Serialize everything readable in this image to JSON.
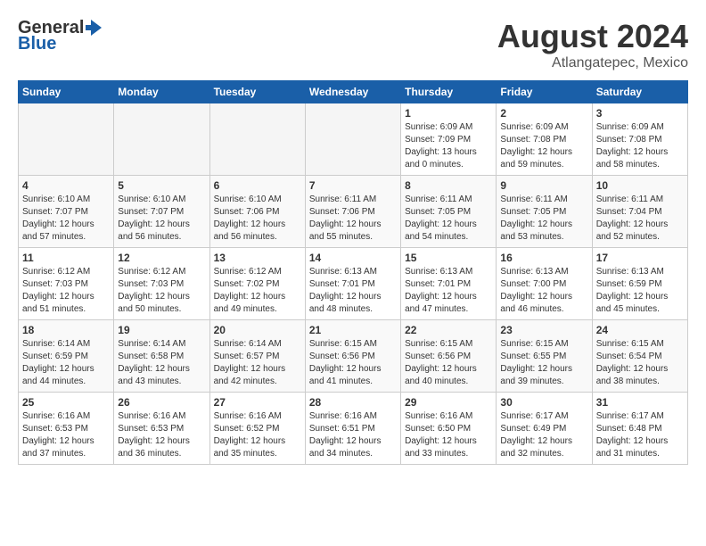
{
  "header": {
    "logo_general": "General",
    "logo_blue": "Blue",
    "main_title": "August 2024",
    "subtitle": "Atlangatepec, Mexico"
  },
  "weekdays": [
    "Sunday",
    "Monday",
    "Tuesday",
    "Wednesday",
    "Thursday",
    "Friday",
    "Saturday"
  ],
  "weeks": [
    [
      {
        "day": "",
        "empty": true
      },
      {
        "day": "",
        "empty": true
      },
      {
        "day": "",
        "empty": true
      },
      {
        "day": "",
        "empty": true
      },
      {
        "day": "1",
        "sunrise": "6:09 AM",
        "sunset": "7:09 PM",
        "daylight": "13 hours and 0 minutes."
      },
      {
        "day": "2",
        "sunrise": "6:09 AM",
        "sunset": "7:08 PM",
        "daylight": "12 hours and 59 minutes."
      },
      {
        "day": "3",
        "sunrise": "6:09 AM",
        "sunset": "7:08 PM",
        "daylight": "12 hours and 58 minutes."
      }
    ],
    [
      {
        "day": "4",
        "sunrise": "6:10 AM",
        "sunset": "7:07 PM",
        "daylight": "12 hours and 57 minutes."
      },
      {
        "day": "5",
        "sunrise": "6:10 AM",
        "sunset": "7:07 PM",
        "daylight": "12 hours and 56 minutes."
      },
      {
        "day": "6",
        "sunrise": "6:10 AM",
        "sunset": "7:06 PM",
        "daylight": "12 hours and 56 minutes."
      },
      {
        "day": "7",
        "sunrise": "6:11 AM",
        "sunset": "7:06 PM",
        "daylight": "12 hours and 55 minutes."
      },
      {
        "day": "8",
        "sunrise": "6:11 AM",
        "sunset": "7:05 PM",
        "daylight": "12 hours and 54 minutes."
      },
      {
        "day": "9",
        "sunrise": "6:11 AM",
        "sunset": "7:05 PM",
        "daylight": "12 hours and 53 minutes."
      },
      {
        "day": "10",
        "sunrise": "6:11 AM",
        "sunset": "7:04 PM",
        "daylight": "12 hours and 52 minutes."
      }
    ],
    [
      {
        "day": "11",
        "sunrise": "6:12 AM",
        "sunset": "7:03 PM",
        "daylight": "12 hours and 51 minutes."
      },
      {
        "day": "12",
        "sunrise": "6:12 AM",
        "sunset": "7:03 PM",
        "daylight": "12 hours and 50 minutes."
      },
      {
        "day": "13",
        "sunrise": "6:12 AM",
        "sunset": "7:02 PM",
        "daylight": "12 hours and 49 minutes."
      },
      {
        "day": "14",
        "sunrise": "6:13 AM",
        "sunset": "7:01 PM",
        "daylight": "12 hours and 48 minutes."
      },
      {
        "day": "15",
        "sunrise": "6:13 AM",
        "sunset": "7:01 PM",
        "daylight": "12 hours and 47 minutes."
      },
      {
        "day": "16",
        "sunrise": "6:13 AM",
        "sunset": "7:00 PM",
        "daylight": "12 hours and 46 minutes."
      },
      {
        "day": "17",
        "sunrise": "6:13 AM",
        "sunset": "6:59 PM",
        "daylight": "12 hours and 45 minutes."
      }
    ],
    [
      {
        "day": "18",
        "sunrise": "6:14 AM",
        "sunset": "6:59 PM",
        "daylight": "12 hours and 44 minutes."
      },
      {
        "day": "19",
        "sunrise": "6:14 AM",
        "sunset": "6:58 PM",
        "daylight": "12 hours and 43 minutes."
      },
      {
        "day": "20",
        "sunrise": "6:14 AM",
        "sunset": "6:57 PM",
        "daylight": "12 hours and 42 minutes."
      },
      {
        "day": "21",
        "sunrise": "6:15 AM",
        "sunset": "6:56 PM",
        "daylight": "12 hours and 41 minutes."
      },
      {
        "day": "22",
        "sunrise": "6:15 AM",
        "sunset": "6:56 PM",
        "daylight": "12 hours and 40 minutes."
      },
      {
        "day": "23",
        "sunrise": "6:15 AM",
        "sunset": "6:55 PM",
        "daylight": "12 hours and 39 minutes."
      },
      {
        "day": "24",
        "sunrise": "6:15 AM",
        "sunset": "6:54 PM",
        "daylight": "12 hours and 38 minutes."
      }
    ],
    [
      {
        "day": "25",
        "sunrise": "6:16 AM",
        "sunset": "6:53 PM",
        "daylight": "12 hours and 37 minutes."
      },
      {
        "day": "26",
        "sunrise": "6:16 AM",
        "sunset": "6:53 PM",
        "daylight": "12 hours and 36 minutes."
      },
      {
        "day": "27",
        "sunrise": "6:16 AM",
        "sunset": "6:52 PM",
        "daylight": "12 hours and 35 minutes."
      },
      {
        "day": "28",
        "sunrise": "6:16 AM",
        "sunset": "6:51 PM",
        "daylight": "12 hours and 34 minutes."
      },
      {
        "day": "29",
        "sunrise": "6:16 AM",
        "sunset": "6:50 PM",
        "daylight": "12 hours and 33 minutes."
      },
      {
        "day": "30",
        "sunrise": "6:17 AM",
        "sunset": "6:49 PM",
        "daylight": "12 hours and 32 minutes."
      },
      {
        "day": "31",
        "sunrise": "6:17 AM",
        "sunset": "6:48 PM",
        "daylight": "12 hours and 31 minutes."
      }
    ]
  ]
}
